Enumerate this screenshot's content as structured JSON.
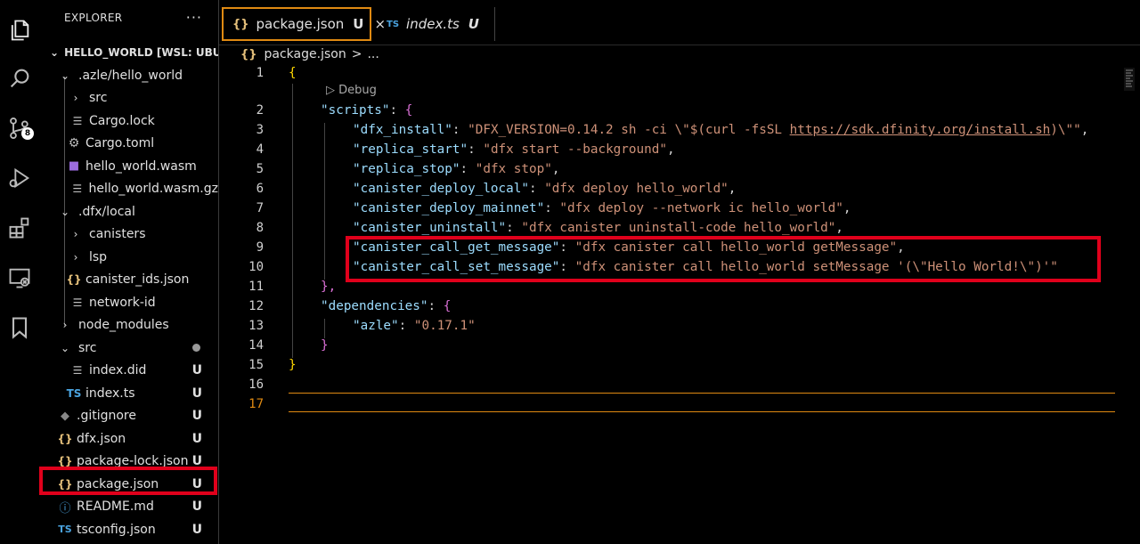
{
  "activity_bar": {
    "icons": [
      "explorer-icon",
      "search-icon",
      "source-control-icon",
      "run-debug-icon",
      "extensions-icon",
      "remote-explorer-icon",
      "bookmark-icon"
    ],
    "source_control_badge": "8"
  },
  "sidebar": {
    "title": "EXPLORER",
    "more": "···",
    "root": "HELLO_WORLD [WSL: UBU...",
    "items": [
      {
        "label": ".azle/hello_world",
        "status": ""
      },
      {
        "label": "src",
        "status": ""
      },
      {
        "label": "Cargo.lock",
        "status": ""
      },
      {
        "label": "Cargo.toml",
        "status": ""
      },
      {
        "label": "hello_world.wasm",
        "status": ""
      },
      {
        "label": "hello_world.wasm.gz",
        "status": ""
      },
      {
        "label": ".dfx/local",
        "status": ""
      },
      {
        "label": "canisters",
        "status": ""
      },
      {
        "label": "lsp",
        "status": ""
      },
      {
        "label": "canister_ids.json",
        "status": ""
      },
      {
        "label": "network-id",
        "status": ""
      },
      {
        "label": "node_modules",
        "status": ""
      },
      {
        "label": "src",
        "status": "dot"
      },
      {
        "label": "index.did",
        "status": "U"
      },
      {
        "label": "index.ts",
        "status": "U"
      },
      {
        "label": ".gitignore",
        "status": "U"
      },
      {
        "label": "dfx.json",
        "status": "U"
      },
      {
        "label": "package-lock.json",
        "status": "U"
      },
      {
        "label": "package.json",
        "status": "U"
      },
      {
        "label": "README.md",
        "status": "U"
      },
      {
        "label": "tsconfig.json",
        "status": "U"
      }
    ]
  },
  "tabs": [
    {
      "icon": "{}",
      "label": "package.json",
      "status": "U",
      "close": "×",
      "active": true
    },
    {
      "icon": "TS",
      "label": "index.ts",
      "status": "U",
      "active": false
    }
  ],
  "breadcrumb": {
    "icon": "{}",
    "file": "package.json",
    "sep": ">",
    "more": "..."
  },
  "editor": {
    "codelens": "Debug",
    "line_numbers": [
      "1",
      "2",
      "3",
      "4",
      "5",
      "6",
      "7",
      "8",
      "9",
      "10",
      "11",
      "12",
      "13",
      "14",
      "15",
      "16",
      "17"
    ],
    "lines": {
      "l1": "{",
      "l2_key": "\"scripts\"",
      "l3_key": "\"dfx_install\"",
      "l3_val_a": "\"DFX_VERSION=0.14.2 sh -ci \\\"$(curl -fsSL ",
      "l3_link": "https://sdk.dfinity.org/install.sh",
      "l3_val_b": ")\\\"\"",
      "l4_key": "\"replica_start\"",
      "l4_val": "\"dfx start --background\"",
      "l5_key": "\"replica_stop\"",
      "l5_val": "\"dfx stop\"",
      "l6_key": "\"canister_deploy_local\"",
      "l6_val": "\"dfx deploy hello_world\"",
      "l7_key": "\"canister_deploy_mainnet\"",
      "l7_val": "\"dfx deploy --network ic hello_world\"",
      "l8_key": "\"canister_uninstall\"",
      "l8_val": "\"dfx canister uninstall-code hello_world\"",
      "l9_key": "\"canister_call_get_message\"",
      "l9_val": "\"dfx canister call hello_world getMessage\"",
      "l10_key": "\"canister_call_set_message\"",
      "l10_val": "\"dfx canister call hello_world setMessage '(\\\"Hello World!\\\")'\"",
      "l11": "},",
      "l12_key": "\"dependencies\"",
      "l13_key": "\"azle\"",
      "l13_val": "\"0.17.1\"",
      "l14": "}",
      "l15": "}"
    }
  }
}
